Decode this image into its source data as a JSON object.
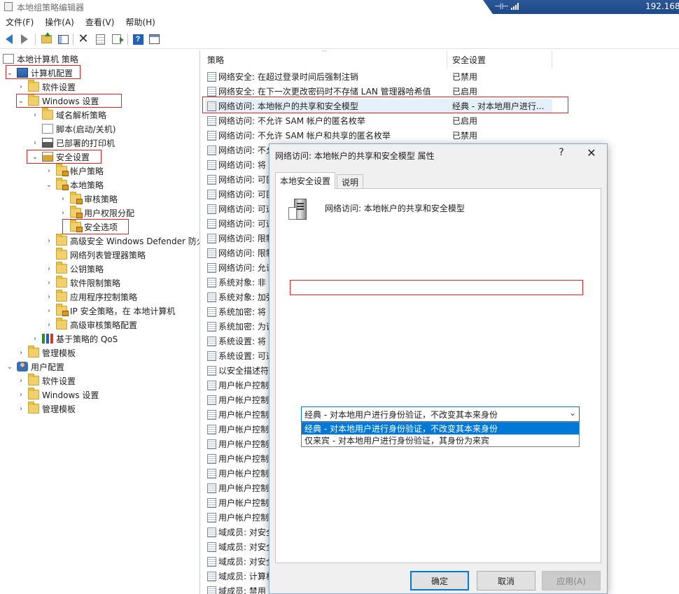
{
  "window": {
    "title": "本地组策略编辑器",
    "remote_ip": "192.168.",
    "remote_pin": "⊣⊢"
  },
  "menu": [
    "文件(F)",
    "操作(A)",
    "查看(V)",
    "帮助(H)"
  ],
  "toolbar": {
    "icons": [
      "back-icon",
      "forward-icon",
      "up-folder-icon",
      "show-hide-tree-icon",
      "delete-icon",
      "properties-icon",
      "export-list-icon",
      "help-icon",
      "show-pane-icon"
    ]
  },
  "tree": {
    "items": [
      {
        "label": "本地计算机 策略",
        "icon": "policy-icon",
        "expander": ""
      },
      {
        "label": "计算机配置",
        "icon": "computer-icon",
        "expander": "⌄"
      },
      {
        "label": "软件设置",
        "icon": "folder-icon",
        "expander": "›"
      },
      {
        "label": "Windows 设置",
        "icon": "folder-icon",
        "expander": "⌄"
      },
      {
        "label": "域名解析策略",
        "icon": "folder-icon",
        "expander": "›"
      },
      {
        "label": "脚本(启动/关机)",
        "icon": "script-icon",
        "expander": ""
      },
      {
        "label": "已部署的打印机",
        "icon": "printer-icon",
        "expander": "›"
      },
      {
        "label": "安全设置",
        "icon": "shield-icon",
        "expander": "⌄"
      },
      {
        "label": "帐户策略",
        "icon": "folder-lock-icon",
        "expander": "›"
      },
      {
        "label": "本地策略",
        "icon": "folder-lock-icon",
        "expander": "⌄"
      },
      {
        "label": "审核策略",
        "icon": "folder-lock-icon",
        "expander": "›"
      },
      {
        "label": "用户权限分配",
        "icon": "folder-lock-icon",
        "expander": "›"
      },
      {
        "label": "安全选项",
        "icon": "folder-lock-icon",
        "expander": ""
      },
      {
        "label": "高级安全 Windows Defender 防火",
        "icon": "folder-icon",
        "expander": "›"
      },
      {
        "label": "网络列表管理器策略",
        "icon": "folder-icon",
        "expander": ""
      },
      {
        "label": "公钥策略",
        "icon": "folder-icon",
        "expander": "›"
      },
      {
        "label": "软件限制策略",
        "icon": "folder-icon",
        "expander": "›"
      },
      {
        "label": "应用程序控制策略",
        "icon": "folder-icon",
        "expander": "›"
      },
      {
        "label": "IP 安全策略，在 本地计算机",
        "icon": "folder-lock-icon",
        "expander": "›"
      },
      {
        "label": "高级审核策略配置",
        "icon": "folder-icon",
        "expander": "›"
      },
      {
        "label": "基于策略的 QoS",
        "icon": "chart-icon",
        "expander": "›"
      },
      {
        "label": "管理模板",
        "icon": "folder-icon",
        "expander": "›"
      },
      {
        "label": "用户配置",
        "icon": "user-icon",
        "expander": "⌄"
      },
      {
        "label": "软件设置",
        "icon": "folder-icon",
        "expander": "›"
      },
      {
        "label": "Windows 设置",
        "icon": "folder-icon",
        "expander": "›"
      },
      {
        "label": "管理模板",
        "icon": "folder-icon",
        "expander": "›"
      }
    ]
  },
  "list": {
    "headers": {
      "policy": "策略",
      "setting": "安全设置",
      "sort_caret": "^"
    },
    "rows": [
      {
        "name": "网络安全: 在超过登录时间后强制注销",
        "value": "已禁用"
      },
      {
        "name": "网络安全: 在下一次更改密码时不存储 LAN 管理器哈希值",
        "value": "已启用"
      },
      {
        "name": "网络访问: 本地帐户的共享和安全模型",
        "value": "经典 - 对本地用户进行..."
      },
      {
        "name": "网络访问: 不允许 SAM 帐户的匿名枚举",
        "value": "已启用"
      },
      {
        "name": "网络访问: 不允许 SAM 帐户和共享的匿名枚举",
        "value": "已禁用"
      },
      {
        "name": "网络访问: 不允",
        "value": ""
      },
      {
        "name": "网络访问: 将",
        "value": ""
      },
      {
        "name": "网络访问: 可匿",
        "value": ""
      },
      {
        "name": "网络访问: 可匿",
        "value": ""
      },
      {
        "name": "网络访问: 可远",
        "value": ""
      },
      {
        "name": "网络访问: 可远",
        "value": ""
      },
      {
        "name": "网络访问: 限制",
        "value": ""
      },
      {
        "name": "网络访问: 限制",
        "value": ""
      },
      {
        "name": "网络访问: 允许",
        "value": ""
      },
      {
        "name": "系统对象: 非",
        "value": ""
      },
      {
        "name": "系统对象: 加强",
        "value": ""
      },
      {
        "name": "系统加密: 将",
        "value": ""
      },
      {
        "name": "系统加密: 为证",
        "value": ""
      },
      {
        "name": "系统设置: 将",
        "value": ""
      },
      {
        "name": "系统设置: 可选",
        "value": ""
      },
      {
        "name": "以安全描述符",
        "value": ""
      },
      {
        "name": "用户帐户控制",
        "value": ""
      },
      {
        "name": "用户帐户控制",
        "value": ""
      },
      {
        "name": "用户帐户控制",
        "value": ""
      },
      {
        "name": "用户帐户控制",
        "value": ""
      },
      {
        "name": "用户帐户控制",
        "value": ""
      },
      {
        "name": "用户帐户控制",
        "value": ""
      },
      {
        "name": "用户帐户控制",
        "value": ""
      },
      {
        "name": "用户帐户控制",
        "value": ""
      },
      {
        "name": "用户帐户控制",
        "value": ""
      },
      {
        "name": "用户帐户控制",
        "value": ""
      },
      {
        "name": "域成员: 对安全",
        "value": ""
      },
      {
        "name": "域成员: 对安全",
        "value": ""
      },
      {
        "name": "域成员: 对安全",
        "value": ""
      },
      {
        "name": "域成员: 计算机",
        "value": ""
      },
      {
        "name": "域成员: 禁用",
        "value": ""
      }
    ]
  },
  "dialog": {
    "title": "网络访问: 本地帐户的共享和安全模型 属性",
    "help_glyph": "?",
    "close_glyph": "✕",
    "tabs": [
      "本地安全设置",
      "说明"
    ],
    "heading": "网络访问: 本地帐户的共享和安全模型",
    "combo": {
      "selected": "经典 - 对本地用户进行身份验证，不改变其本来身份",
      "arrow": "⌄",
      "options": [
        "经典 - 对本地用户进行身份验证，不改变其本来身份",
        "仅来宾 - 对本地用户进行身份验证，其身份为来宾"
      ]
    },
    "buttons": {
      "ok": "确定",
      "cancel": "取消",
      "apply": "应用(A)"
    }
  },
  "colors": {
    "highlight": "#0078d7",
    "annotation_red": "#e02424",
    "selection": "#e5f0fb"
  }
}
